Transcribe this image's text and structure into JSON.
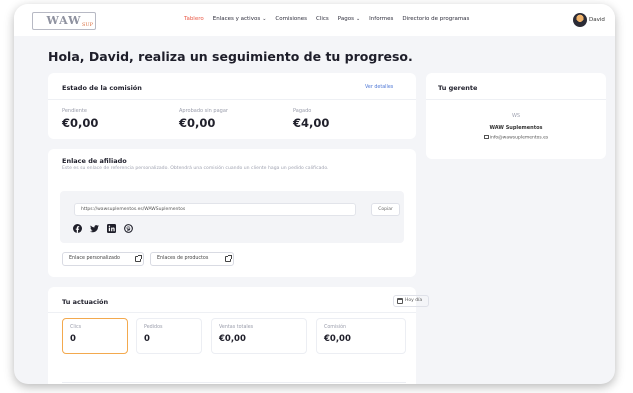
{
  "header": {
    "logo_text": "WAW",
    "logo_sub": "SUP",
    "nav": [
      {
        "label": "Tablero",
        "active": true,
        "dropdown": false
      },
      {
        "label": "Enlaces y activos",
        "active": false,
        "dropdown": true
      },
      {
        "label": "Comisiones",
        "active": false,
        "dropdown": false
      },
      {
        "label": "Clics",
        "active": false,
        "dropdown": false
      },
      {
        "label": "Pagos",
        "active": false,
        "dropdown": true
      },
      {
        "label": "Informes",
        "active": false,
        "dropdown": false
      },
      {
        "label": "Directorio de programas",
        "active": false,
        "dropdown": false
      }
    ],
    "user_name": "David",
    "chevron_icon": "chevron-down-icon"
  },
  "greeting": "Hola, David, realiza un seguimiento de tu progreso.",
  "commission": {
    "title": "Estado de la comisión",
    "details_link": "Ver detalles",
    "stats": [
      {
        "label": "Pendiente",
        "value": "€0,00"
      },
      {
        "label": "Aprobado sin pagar",
        "value": "€0,00"
      },
      {
        "label": "Pagado",
        "value": "€4,00"
      }
    ]
  },
  "manager": {
    "title": "Tu gerente",
    "initials": "WS",
    "name": "WAW Suplementos",
    "email": "info@wawsuplementos.es",
    "email_icon": "mail-icon"
  },
  "affiliate_link": {
    "title": "Enlace de afiliado",
    "description": "Este es su enlace de referencia personalizado. Obtendrá una comisión cuando un cliente haga un pedido calificado.",
    "url": "https://wawsuplementos.es/WAWSuplementos",
    "copy_label": "Copiar",
    "social_icons": [
      "facebook-icon",
      "twitter-icon",
      "linkedin-icon",
      "pinterest-icon"
    ],
    "custom_link_label": "Enlace personalizado",
    "product_links_label": "Enlaces de productos",
    "external_icon": "external-link-icon"
  },
  "performance": {
    "title": "Tu actuación",
    "date_label": "Hoy día",
    "date_icon": "calendar-icon",
    "metrics": [
      {
        "label": "Clics",
        "value": "0",
        "selected": true
      },
      {
        "label": "Pedidos",
        "value": "0",
        "selected": false
      },
      {
        "label": "Ventas totales",
        "value": "€0,00",
        "selected": false
      },
      {
        "label": "Comisión",
        "value": "€0,00",
        "selected": false
      }
    ]
  },
  "colors": {
    "accent_active_nav": "#ea5a47",
    "selected_metric_border": "#f3a94e",
    "link": "#4f78d6",
    "background": "#f4f5f8"
  }
}
